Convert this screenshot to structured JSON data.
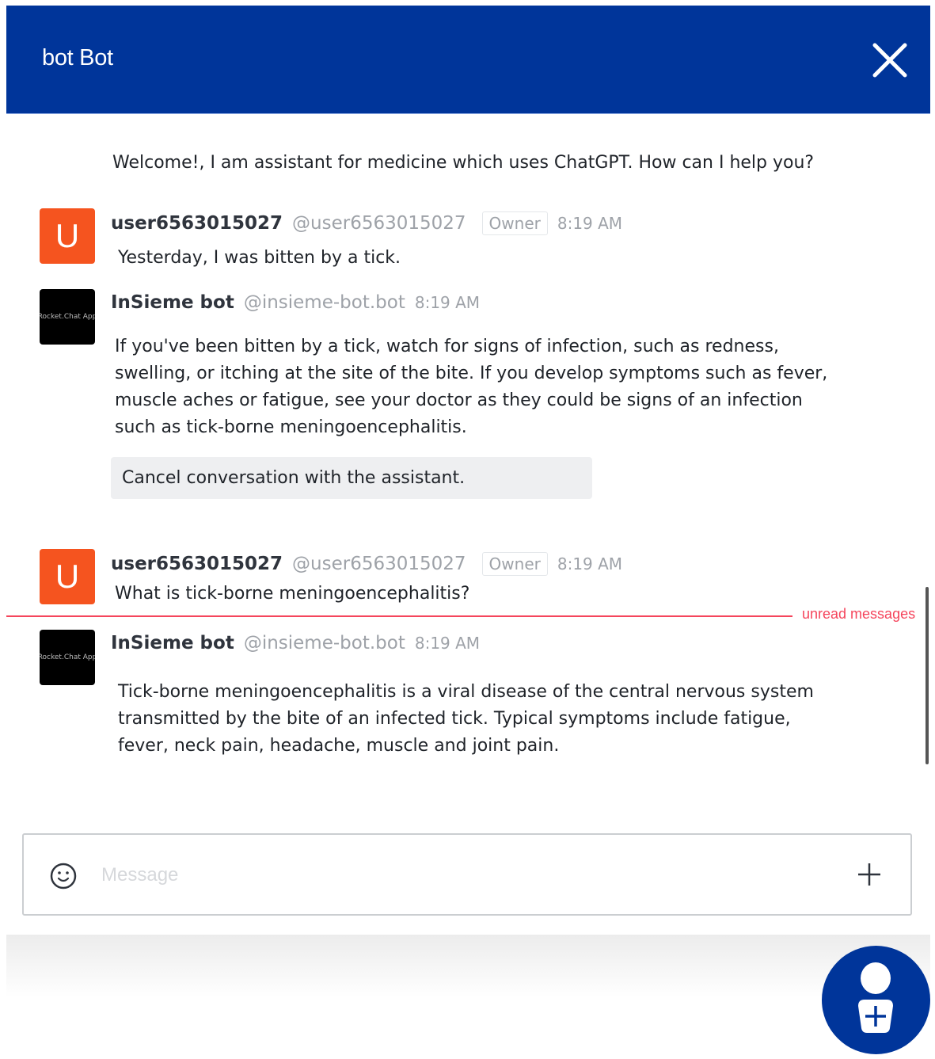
{
  "header": {
    "title": "bot Bot",
    "close_icon": "close-icon"
  },
  "welcome": "Welcome!, I am assistant for medicine which uses ChatGPT. How can I help you?",
  "messages": [
    {
      "avatar": "U",
      "name": "user6563015027",
      "handle": "@user6563015027",
      "badge": "Owner",
      "time": "8:19 AM",
      "text": "Yesterday, I was bitten by a tick."
    },
    {
      "avatar": "Rocket.Chat App",
      "name": "InSieme bot",
      "handle": "@insieme-bot.bot",
      "time": "8:19 AM",
      "lines": [
        "If you've been bitten by a tick, watch for signs of infection, such as redness,",
        "swelling, or itching at the site of the bite. If you develop symptoms such as fever,",
        "muscle aches or fatigue, see your doctor as they could be signs of an infection",
        "such as tick-borne meningoencephalitis."
      ],
      "action": "Cancel conversation with the assistant."
    },
    {
      "avatar": "U",
      "name": "user6563015027",
      "handle": "@user6563015027",
      "badge": "Owner",
      "time": "8:19 AM",
      "text": "What is tick-borne meningoencephalitis?"
    },
    {
      "avatar": "Rocket.Chat App",
      "name": "InSieme bot",
      "handle": "@insieme-bot.bot",
      "time": "8:19 AM",
      "lines": [
        "Tick-borne meningoencephalitis is a viral disease of the central nervous system",
        "transmitted by the bite of an infected tick. Typical symptoms include fatigue,",
        "fever, neck pain, headache, muscle and joint pain."
      ]
    }
  ],
  "unread_label": "unread messages",
  "composer": {
    "placeholder": "Message",
    "value": "",
    "emoji_icon": "smiley-icon",
    "attach_icon": "plus-icon"
  },
  "fab": {
    "icon": "user-plus-icon"
  },
  "colors": {
    "brand": "#00359a",
    "avatar_user": "#f5541f",
    "unread": "#f5455c"
  }
}
